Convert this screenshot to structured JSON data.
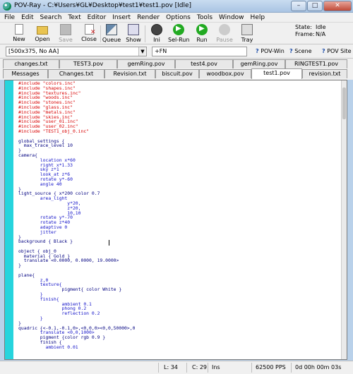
{
  "window": {
    "title": "POV-Ray - C:¥Users¥GL¥Desktop¥test1¥test1.pov [Idle]",
    "minimize": "–",
    "maximize": "□",
    "close": "✕"
  },
  "menu": [
    "File",
    "Edit",
    "Search",
    "Text",
    "Editor",
    "Insert",
    "Render",
    "Options",
    "Tools",
    "Window",
    "Help"
  ],
  "toolbar": {
    "buttons": [
      {
        "label": "New",
        "icon": "new-file-icon"
      },
      {
        "label": "Open",
        "icon": "open-folder-icon"
      },
      {
        "label": "Save",
        "icon": "save-disk-icon",
        "disabled": true
      },
      {
        "label": "Close",
        "icon": "close-file-icon"
      },
      {
        "label": "Queue",
        "icon": "queue-icon"
      },
      {
        "label": "Show",
        "icon": "show-icon"
      },
      {
        "label": "Ini",
        "icon": "ini-icon"
      },
      {
        "label": "Sel-Run",
        "icon": "sel-run-icon"
      },
      {
        "label": "Run",
        "icon": "run-icon"
      },
      {
        "label": "Pause",
        "icon": "pause-icon",
        "disabled": true
      },
      {
        "label": "Tray",
        "icon": "tray-icon"
      }
    ],
    "state_label": "State:",
    "state_value": "Idle",
    "frame_label": "Frame:",
    "frame_value": "N/A"
  },
  "toolbar2": {
    "resolution": "[500x375, No AA]",
    "command_line": "+FN",
    "links": [
      "POV-Win",
      "Scene",
      "POV Site"
    ]
  },
  "tabs": {
    "row1": [
      "changes.txt",
      "TEST3.pov",
      "gemRing.pov",
      "test4.pov",
      "gemRing.pov",
      "RINGTEST1.pov"
    ],
    "row2": [
      "Messages",
      "Changes.txt",
      "Revision.txt",
      "biscuit.pov",
      "woodbox.pov",
      "test1.pov",
      "revision.txt"
    ],
    "active": "test1.pov"
  },
  "editor": {
    "lines": [
      {
        "t": "#include \"colors.inc\"",
        "c": "red"
      },
      {
        "t": "#include \"shapes.inc\"",
        "c": "red"
      },
      {
        "t": "#include \"textures.inc\"",
        "c": "red"
      },
      {
        "t": "#include \"woods.inc\"",
        "c": "red"
      },
      {
        "t": "#include \"stones.inc\"",
        "c": "red"
      },
      {
        "t": "#include \"glass.inc\"",
        "c": "red"
      },
      {
        "t": "#include \"metals.inc\"",
        "c": "red"
      },
      {
        "t": "#include \"skies.inc\"",
        "c": "red"
      },
      {
        "t": "#include \"user_01.inc\"",
        "c": "red"
      },
      {
        "t": "#include \"user_02.inc\"",
        "c": "red"
      },
      {
        "t": "#include \"TEST1_obj_0.inc\"",
        "c": "red"
      },
      {
        "t": "",
        "c": "black"
      },
      {
        "t": "global_settings {",
        "c": "navy"
      },
      {
        "t": "  max_trace_level 10",
        "c": "navy"
      },
      {
        "t": "}",
        "c": "navy"
      },
      {
        "t": "camera{",
        "c": "navy"
      },
      {
        "t": "        location x*60",
        "c": "blue"
      },
      {
        "t": "        right x*1.33",
        "c": "blue"
      },
      {
        "t": "        sky z*1",
        "c": "blue"
      },
      {
        "t": "        look_at z*6",
        "c": "blue"
      },
      {
        "t": "        rotate y*-60",
        "c": "blue"
      },
      {
        "t": "        angle 40",
        "c": "blue"
      },
      {
        "t": "}",
        "c": "navy"
      },
      {
        "t": "light_source { x*200 color 0.7",
        "c": "navy"
      },
      {
        "t": "        area_light",
        "c": "blue"
      },
      {
        "t": "                  y*20,",
        "c": "blue"
      },
      {
        "t": "                  z*20,",
        "c": "blue"
      },
      {
        "t": "                  10,10",
        "c": "blue"
      },
      {
        "t": "        rotate y*-70",
        "c": "blue"
      },
      {
        "t": "        rotate z*40",
        "c": "blue"
      },
      {
        "t": "        adaptive 0",
        "c": "blue"
      },
      {
        "t": "        jitter",
        "c": "blue"
      },
      {
        "t": "}",
        "c": "navy"
      },
      {
        "t": "background { Black }",
        "c": "navy"
      },
      {
        "t": "",
        "c": "black"
      },
      {
        "t": "object { obj_0",
        "c": "navy"
      },
      {
        "t": "  material { Gold }",
        "c": "navy"
      },
      {
        "t": "  translate <0.0000, 0.0000, 19.0000>",
        "c": "navy"
      },
      {
        "t": "}",
        "c": "navy"
      },
      {
        "t": "",
        "c": "black"
      },
      {
        "t": "plane{",
        "c": "navy"
      },
      {
        "t": "        z,0",
        "c": "blue"
      },
      {
        "t": "        texture{",
        "c": "blue"
      },
      {
        "t": "                pigment{ color White }",
        "c": "navy"
      },
      {
        "t": "        }",
        "c": "blue"
      },
      {
        "t": "        finish{",
        "c": "blue"
      },
      {
        "t": "                ambient 0.1",
        "c": "blue"
      },
      {
        "t": "                phong 0.2",
        "c": "blue"
      },
      {
        "t": "                reflection 0.2",
        "c": "blue"
      },
      {
        "t": "        }",
        "c": "blue"
      },
      {
        "t": "}",
        "c": "navy"
      },
      {
        "t": "quadric {<-0.1,-0.1,0>,<0,0,0><0,0,50000>,0",
        "c": "navy"
      },
      {
        "t": "        translate <0,0,1000>",
        "c": "blue"
      },
      {
        "t": "        pigment {color rgb 0.9 }",
        "c": "navy"
      },
      {
        "t": "        finish {",
        "c": "navy"
      },
      {
        "t": "          ambient 0.01",
        "c": "blue"
      }
    ]
  },
  "statusbar": {
    "line": "L: 34",
    "col": "C: 29",
    "mode": "Ins",
    "pps": "62500 PPS",
    "time": "0d 00h 00m 03s"
  }
}
